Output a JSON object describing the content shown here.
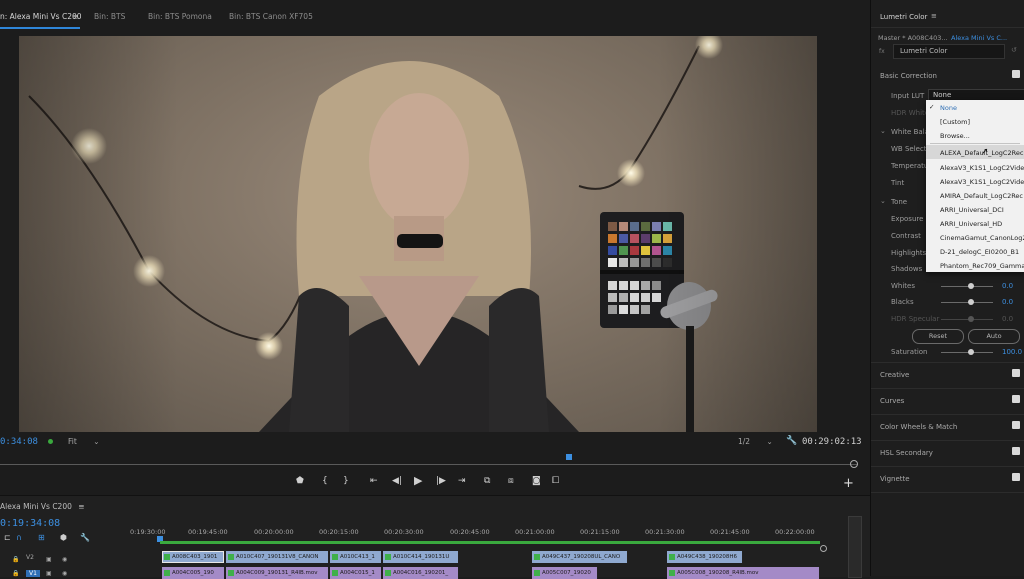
{
  "tabs": [
    {
      "label": "n: Alexa Mini Vs C200",
      "active": true
    },
    {
      "label": "Bin: BTS",
      "active": false
    },
    {
      "label": "Bin: BTS Pomona",
      "active": false
    },
    {
      "label": "Bin: BTS Canon XF705",
      "active": false
    }
  ],
  "viewer": {
    "timecode_left": "0:34:08",
    "fit": "Fit",
    "resolution": "1/2",
    "timecode_right": "00:29:02:13",
    "plus_label": "+"
  },
  "timeline": {
    "sequence_title": "Alexa Mini Vs C200",
    "timecode": "0:19:34:08",
    "ruler": [
      "0:19:30:00",
      "00:19:45:00",
      "00:20:00:00",
      "00:20:15:00",
      "00:20:30:00",
      "00:20:45:00",
      "00:21:00:00",
      "00:21:15:00",
      "00:21:30:00",
      "00:21:45:00",
      "00:22:00:00"
    ],
    "track_v2": "V2",
    "track_v1": "V1",
    "clips_v2": [
      "A008C403_1901",
      "A010C407_190131V8_CANON",
      "A010C413_1",
      "A010C414_190131U",
      "A049C437_190208UL_CANO",
      "A049C438_190208H6"
    ],
    "clips_v1": [
      "A004C005_190",
      "A004C009_190131_R4IB.mov",
      "A004C015_1",
      "A004C016_190201_",
      "A005C007_19020",
      "A005C008_190208_R4IB.mov"
    ]
  },
  "lumetri": {
    "title": "Lumetri Color",
    "master": "Master * A008C403...",
    "sequence_link": "Alexa Mini Vs C...",
    "fx_label": "fx",
    "effect_name": "Lumetri Color",
    "basic_correction": "Basic Correction",
    "input_lut_label": "Input LUT",
    "input_lut_value": "None",
    "hdr_white": "HDR White",
    "white_balance": "White Bala",
    "wb_selector": "WB Selecto",
    "temperature": "Temperatu",
    "tint": "Tint",
    "tone": "Tone",
    "exposure": "Exposure",
    "contrast": "Contrast",
    "highlights": "Highlights",
    "shadows": "Shadows",
    "whites_label": "Whites",
    "whites_value": "0.0",
    "blacks_label": "Blacks",
    "blacks_value": "0.0",
    "hdr_specular_label": "HDR Specular",
    "hdr_specular_value": "0.0",
    "reset": "Reset",
    "auto": "Auto",
    "saturation_label": "Saturation",
    "saturation_value": "100.0",
    "sections": [
      "Creative",
      "Curves",
      "Color Wheels & Match",
      "HSL Secondary",
      "Vignette"
    ],
    "lut_options": [
      "None",
      "[Custom]",
      "Browse...",
      "ALEXA_Default_LogC2Rec",
      "AlexaV3_K1S1_LogC2Vide",
      "AlexaV3_K1S1_LogC2Vide",
      "AMIRA_Default_LogC2Rec",
      "ARRI_Universal_DCI",
      "ARRI_Universal_HD",
      "CinemaGamut_CanonLog2",
      "D-21_delogC_EI0200_B1",
      "Phantom_Rec709_Gamma"
    ]
  },
  "colors": {
    "accent": "#2f86d8",
    "timecode": "#3c8fe0",
    "clip_v2": "#8fa9d0",
    "clip_v1": "#a48ac7",
    "green_bar": "#3aa93e"
  }
}
